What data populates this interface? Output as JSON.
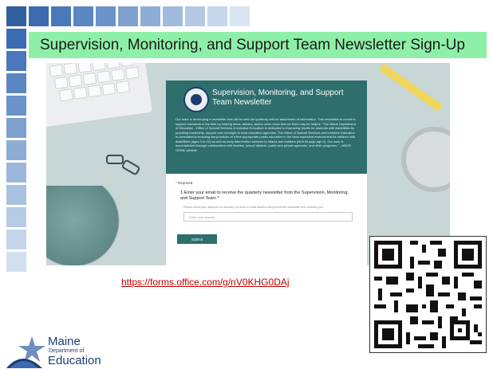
{
  "slide": {
    "title": "Supervision, Monitoring, and Support Team Newsletter Sign-Up",
    "link": "https://forms.office.com/g/nV0KHG0DAj",
    "colors": {
      "banner": "#8ef0a8",
      "link": "#c00000",
      "form_header": "#2e6f6d",
      "brand_blue": "#1f3c6e"
    }
  },
  "form": {
    "title": "Supervision, Monitoring, and Support Team Newsletter",
    "body": "Our team is developing a newsletter that will be sent out quarterly with an assortment of information. This newsletter is meant to support educators in the field by sharing ideas, articles, and/or other news that we think may be helpful. \"The Maine Department of Education - Office of Special Services & Inclusive Education is dedicated to improving results for students with disabilities by providing leadership, support and oversight to local education agencies. The Office of Special Services and Inclusive Education is committed to ensuring the provision of a free appropriate public education in the least restrictive environment for children with disabilities (ages 3 to 22) as well as early intervention services to infants and toddlers (birth through age 2). Our work is accomplished through collaboration with families, school districts, public and private agencies, and other programs.\" - MDOE-OSSIE website",
    "required_note": "* Required",
    "question": "1.Enter your email to receive the quarterly newsletter from the Supervision, Monitoring, and Support Team *",
    "hint": "Please check your response for accuracy. An error in email address will prevent the newsletter from reaching you.",
    "answer_placeholder": "Enter your answer",
    "submit_label": "Submit"
  },
  "logo": {
    "line1": "Maine",
    "line2": "Department of",
    "line3": "Education"
  },
  "icons": {
    "seal": "maine-seal-icon",
    "qr": "qr-code-icon",
    "logo_star": "star-icon"
  }
}
